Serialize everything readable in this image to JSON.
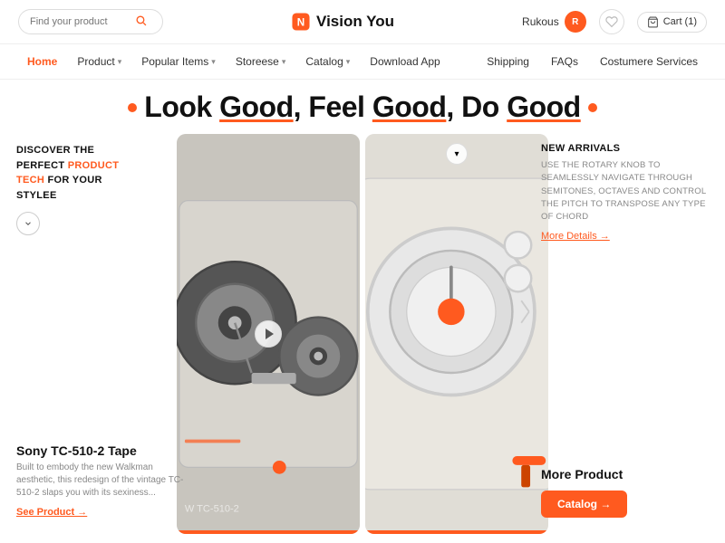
{
  "header": {
    "search_placeholder": "Find your product",
    "logo_text": "Vision You",
    "user_name": "Rukous",
    "user_initial": "R",
    "cart_label": "Cart (1)"
  },
  "nav": {
    "items": [
      {
        "label": "Home",
        "active": true,
        "has_arrow": false
      },
      {
        "label": "Product",
        "active": false,
        "has_arrow": true
      },
      {
        "label": "Popular Items",
        "active": false,
        "has_arrow": true
      },
      {
        "label": "Storeese",
        "active": false,
        "has_arrow": true
      },
      {
        "label": "Catalog",
        "active": false,
        "has_arrow": true
      },
      {
        "label": "Download App",
        "active": false,
        "has_arrow": false
      }
    ],
    "right_items": [
      {
        "label": "Shipping"
      },
      {
        "label": "FAQs"
      },
      {
        "label": "Costumere Services"
      }
    ]
  },
  "hero": {
    "headline": "Look Good, Feel Good, Do Good",
    "headline_parts": [
      "Look ",
      "Good",
      ", Feel ",
      "Good",
      ", Do ",
      "Good"
    ],
    "left_panel": {
      "discover_line1": "DISCOVER THE",
      "discover_line2": "PERFECT",
      "discover_orange1": "PRODUCT",
      "discover_line3": "TECH",
      "discover_line4": "FOR YOUR",
      "discover_line5": "STYLEE"
    },
    "product_left": {
      "name": "Sony TC-510-2 Tape",
      "description": "Built to embody the new Walkman aesthetic, this redesign of the vintage TC-510-2 slaps you with its sexiness...",
      "see_product_label": "See Product →"
    },
    "right_panel": {
      "new_arrivals_title": "NEW ARRIVALS",
      "description": "USE THE ROTARY KNOB TO SEAMLESSLY NAVIGATE THROUGH SEMITONES, OCTAVES AND CONTROL THE PITCH TO TRANSPOSE ANY TYPE OF CHORD",
      "more_details_label": "More Details →"
    },
    "more_product": {
      "title": "More Product",
      "catalog_label": "Catalog →"
    },
    "image_left_label": "W TC-510-2",
    "image_right_label": ""
  }
}
